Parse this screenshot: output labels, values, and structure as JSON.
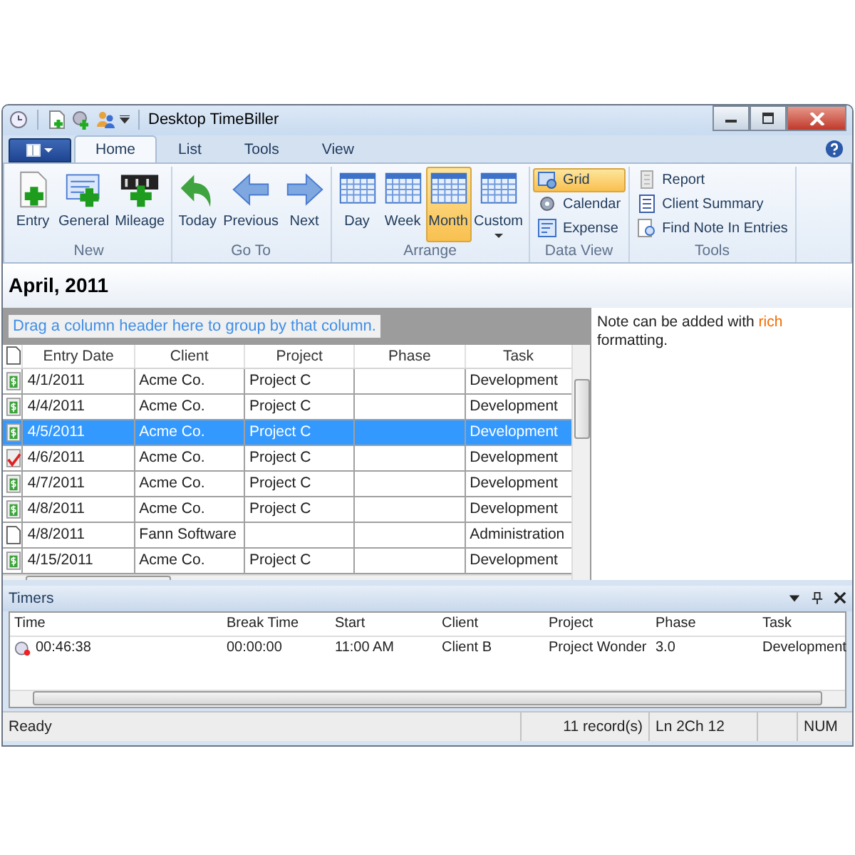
{
  "window": {
    "title": "Desktop TimeBiller"
  },
  "ribbon_tabs": [
    {
      "label": "Home",
      "selected": true
    },
    {
      "label": "List",
      "selected": false
    },
    {
      "label": "Tools",
      "selected": false
    },
    {
      "label": "View",
      "selected": false
    }
  ],
  "ribbon_groups": [
    {
      "label": "New",
      "kind": "large",
      "buttons": [
        {
          "label": "Entry",
          "selected": false
        },
        {
          "label": "General",
          "selected": false
        },
        {
          "label": "Mileage",
          "selected": false
        }
      ]
    },
    {
      "label": "Go To",
      "kind": "large",
      "buttons": [
        {
          "label": "Today",
          "selected": false
        },
        {
          "label": "Previous",
          "selected": false
        },
        {
          "label": "Next",
          "selected": false
        }
      ]
    },
    {
      "label": "Arrange",
      "kind": "large",
      "buttons": [
        {
          "label": "Day",
          "selected": false
        },
        {
          "label": "Week",
          "selected": false
        },
        {
          "label": "Month",
          "selected": true
        },
        {
          "label": "Custom",
          "selected": false,
          "dropdown": true
        }
      ]
    },
    {
      "label": "Data View",
      "kind": "small",
      "buttons": [
        {
          "label": "Grid",
          "selected": true
        },
        {
          "label": "Calendar",
          "selected": false
        },
        {
          "label": "Expense",
          "selected": false
        }
      ]
    },
    {
      "label": "Tools",
      "kind": "small",
      "buttons": [
        {
          "label": "Report",
          "selected": false
        },
        {
          "label": "Client Summary",
          "selected": false
        },
        {
          "label": "Find Note In Entries",
          "selected": false
        }
      ]
    }
  ],
  "heading": "April, 2011",
  "group_hint": "Drag a column header here to group by that column.",
  "grid": {
    "columns": [
      "Entry Date",
      "Client",
      "Project",
      "Phase",
      "Task"
    ],
    "rows": [
      {
        "kind": "billable",
        "selected": false,
        "cells": [
          "4/1/2011",
          "Acme Co.",
          "Project C",
          "",
          "Development"
        ]
      },
      {
        "kind": "billable",
        "selected": false,
        "cells": [
          "4/4/2011",
          "Acme Co.",
          "Project C",
          "",
          "Development"
        ]
      },
      {
        "kind": "billable",
        "selected": true,
        "cells": [
          "4/5/2011",
          "Acme Co.",
          "Project C",
          "",
          "Development"
        ]
      },
      {
        "kind": "billed",
        "selected": false,
        "cells": [
          "4/6/2011",
          "Acme Co.",
          "Project C",
          "",
          "Development"
        ]
      },
      {
        "kind": "billable",
        "selected": false,
        "cells": [
          "4/7/2011",
          "Acme Co.",
          "Project C",
          "",
          "Development"
        ]
      },
      {
        "kind": "billable",
        "selected": false,
        "cells": [
          "4/8/2011",
          "Acme Co.",
          "Project C",
          "",
          "Development"
        ]
      },
      {
        "kind": "plain",
        "selected": false,
        "cells": [
          "4/8/2011",
          "Fann Software",
          "",
          "",
          "Administration"
        ]
      },
      {
        "kind": "billable",
        "selected": false,
        "cells": [
          "4/15/2011",
          "Acme Co.",
          "Project C",
          "",
          "Development"
        ]
      }
    ]
  },
  "note": {
    "before": "Note can be added with",
    "highlight": "rich",
    "after": "formatting."
  },
  "timers": {
    "title": "Timers",
    "columns": [
      "Time",
      "Break Time",
      "Start",
      "Client",
      "Project",
      "Phase",
      "Task"
    ],
    "rows": [
      {
        "cells": [
          "00:46:38",
          "00:00:00",
          "11:00 AM",
          "Client B",
          "Project Wonder",
          "3.0",
          "Development"
        ]
      }
    ]
  },
  "status_bar": [
    "Ready",
    "11 record(s)",
    "Ln 2Ch 12",
    "NUM"
  ]
}
